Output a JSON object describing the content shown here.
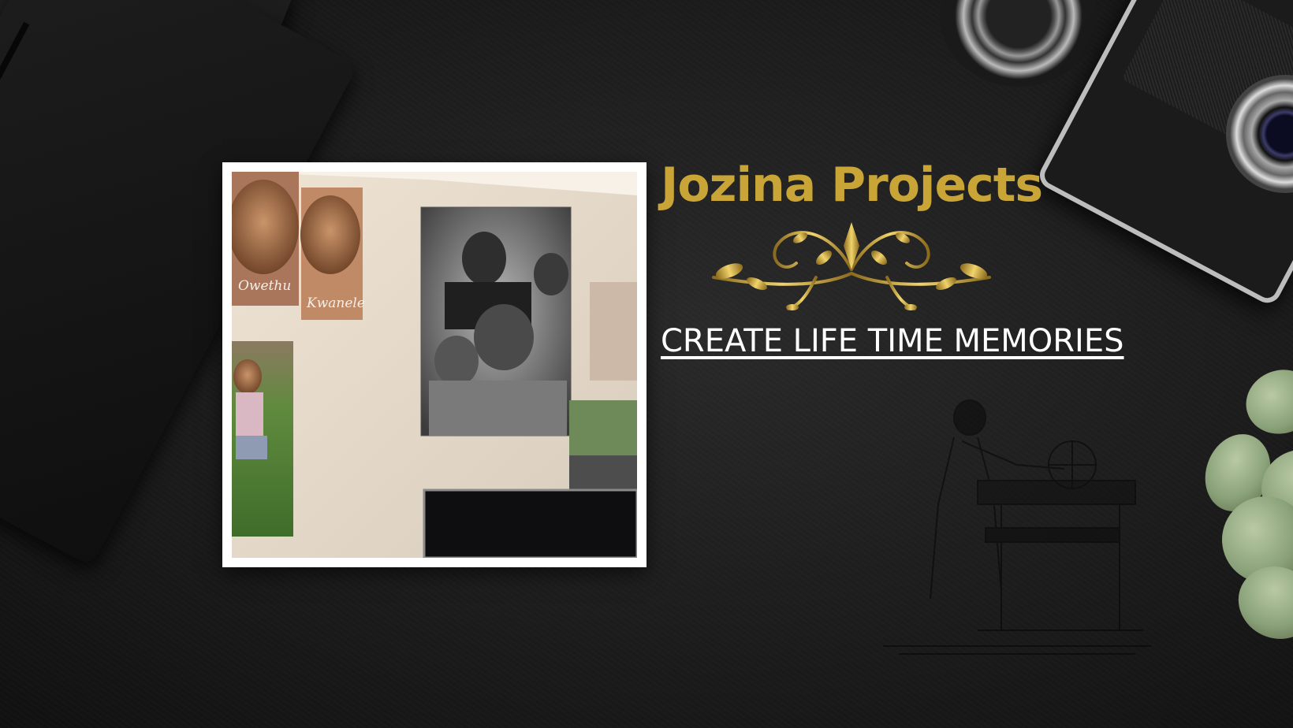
{
  "brand": {
    "title": "Jozina Projects",
    "tagline": "CREATE LIFE TIME MEMORIES",
    "title_color": "#c9a437",
    "tagline_color": "#ffffff"
  },
  "photo": {
    "canvas_captions": [
      "Owethu",
      "Kwanele"
    ]
  },
  "icons": [
    "ornament-flourish",
    "camera",
    "camera-lens",
    "notebook",
    "succulent-plant",
    "printing-press-engraving"
  ],
  "colors": {
    "background": "#1c1c1c",
    "gold": "#c9a437"
  }
}
